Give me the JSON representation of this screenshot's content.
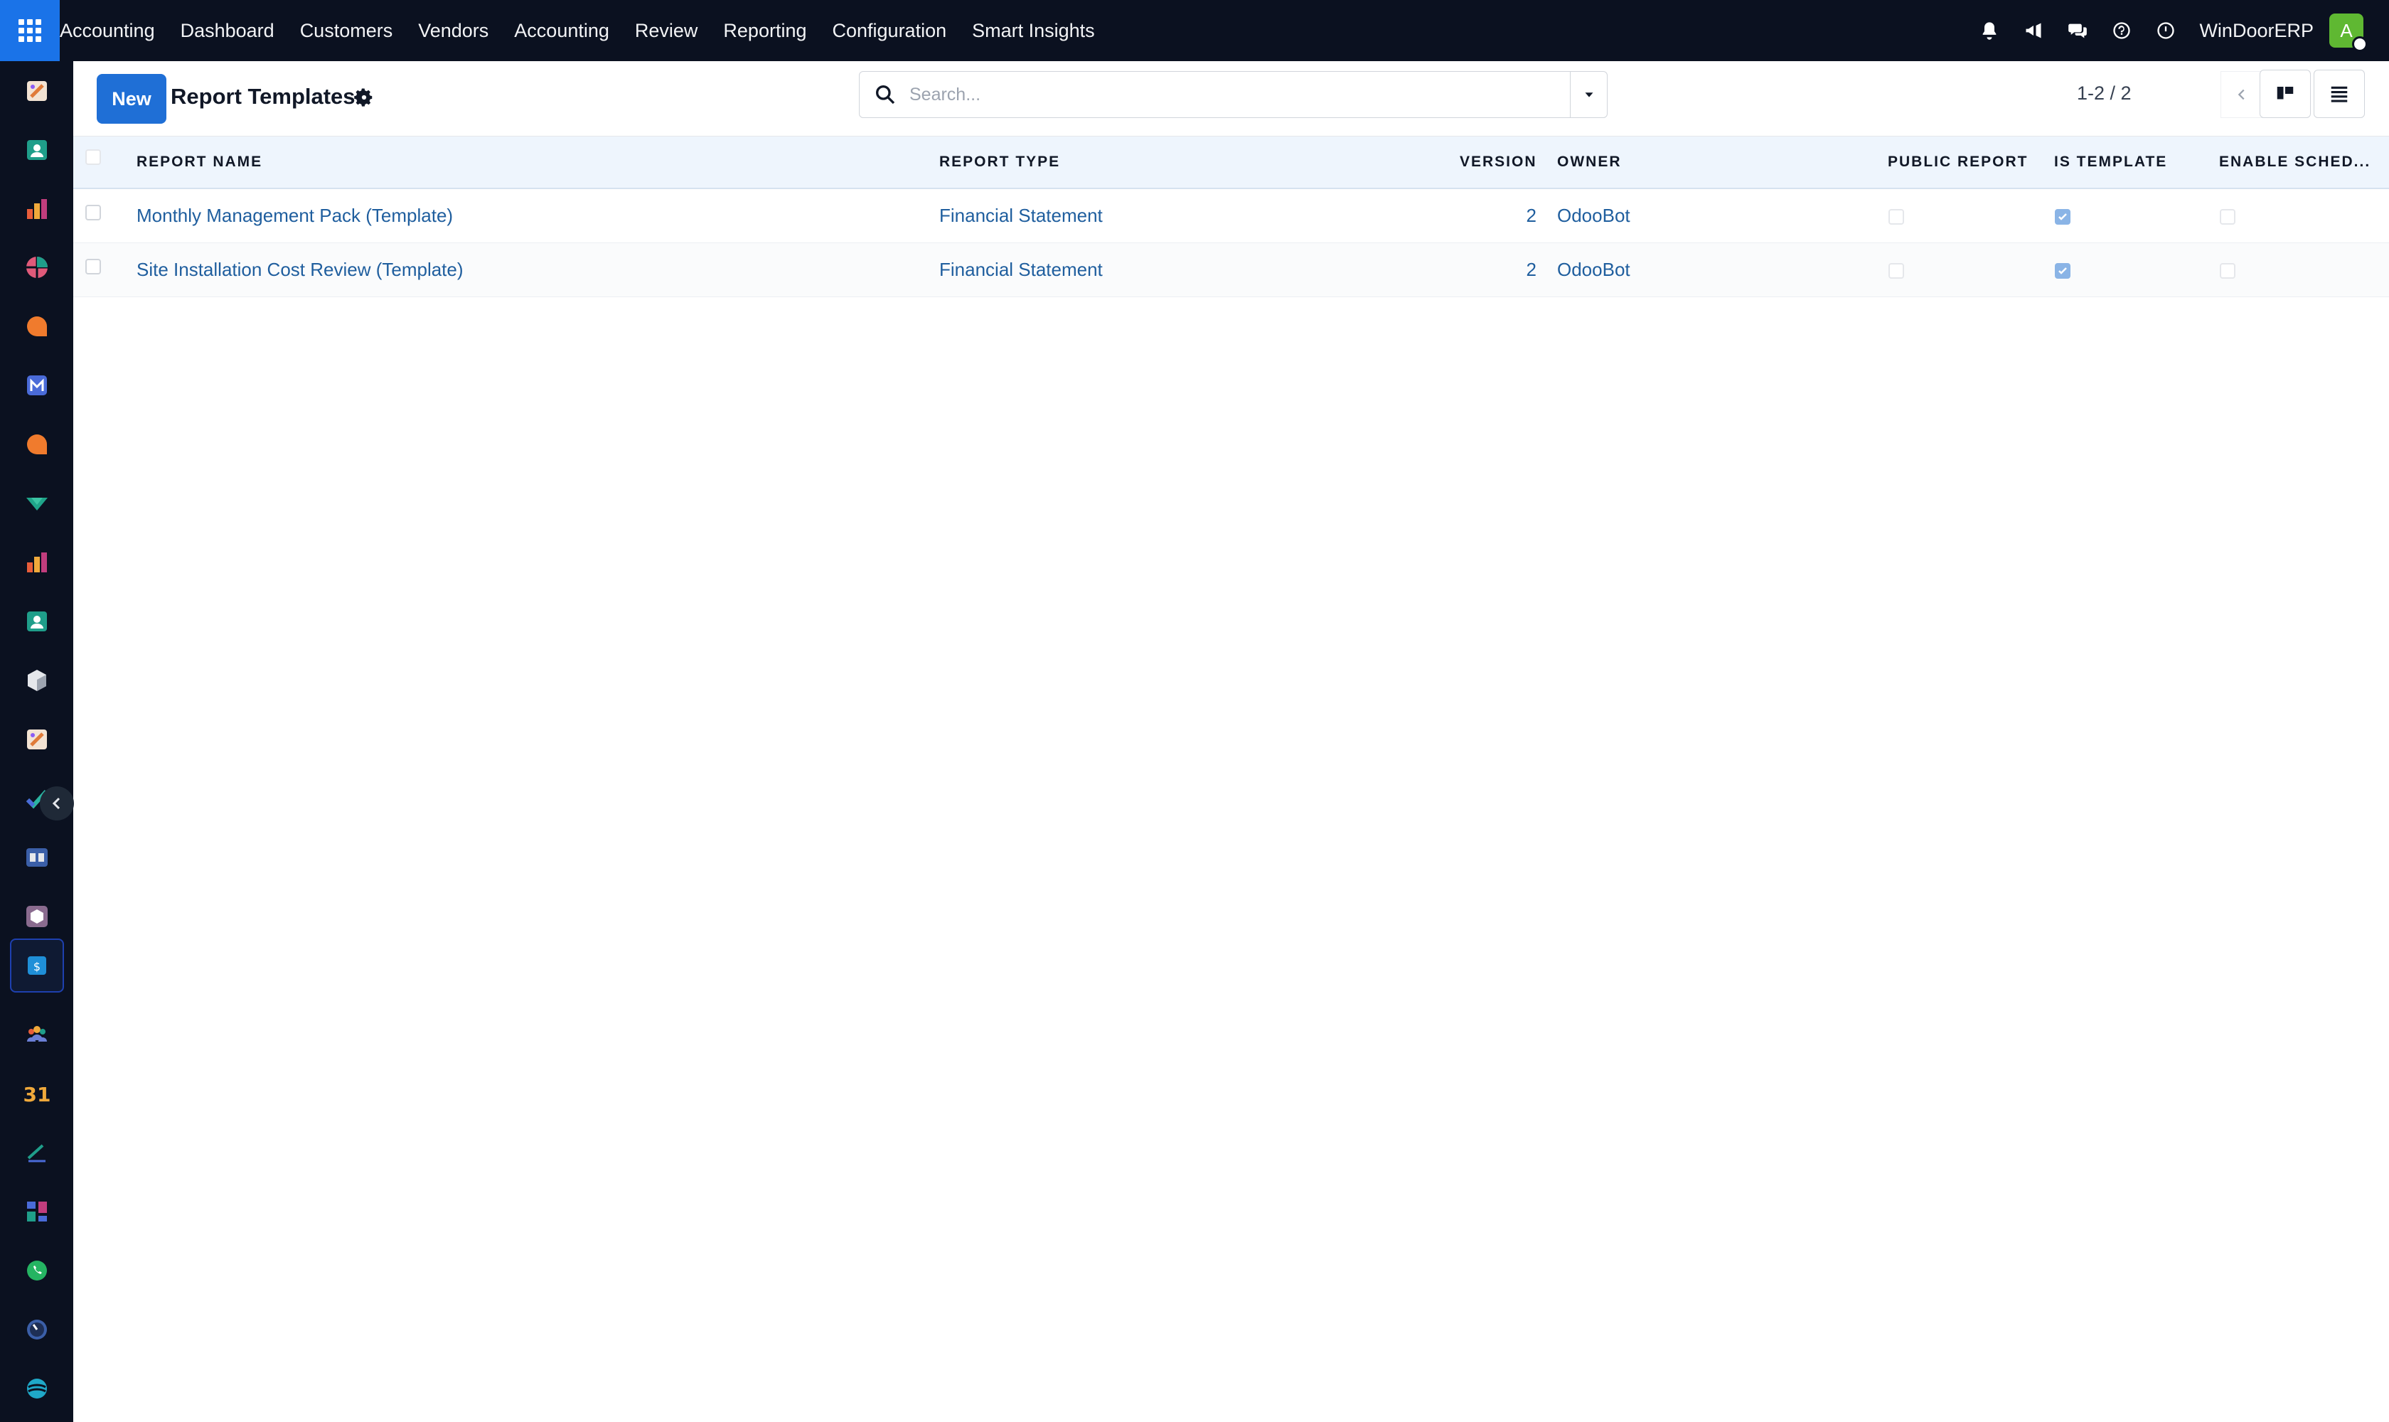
{
  "topbar": {
    "menu": [
      "Accounting",
      "Dashboard",
      "Customers",
      "Vendors",
      "Accounting",
      "Review",
      "Reporting",
      "Configuration",
      "Smart Insights"
    ],
    "company": "WinDoorERP",
    "avatar_letter": "A",
    "tray_icons": [
      "bell-icon",
      "megaphone-icon",
      "chat-icon",
      "help-icon",
      "clock-icon"
    ]
  },
  "sidebar": {
    "apps": [
      "accounting-app-icon",
      "contacts-app-icon",
      "reporting-app-icon",
      "dashboard-app-icon",
      "discuss-app-icon",
      "email-marketing-app-icon",
      "livechat-app-icon",
      "project-app-icon",
      "reports-app-icon",
      "employees-app-icon",
      "inventory-app-icon",
      "invoicing-app-icon",
      "todo-app-icon",
      "knowledge-app-icon",
      "website-app-icon",
      "accounting-reports-app-icon",
      "team-app-icon",
      "calendar-app-icon",
      "sign-app-icon",
      "dashboards-app-icon",
      "whatsapp-app-icon",
      "timer-app-icon",
      "odoo-app-icon"
    ],
    "calendar_label": "31"
  },
  "control": {
    "new_label": "New",
    "title": "Report Templates",
    "search_placeholder": "Search...",
    "pager": "1-2 / 2"
  },
  "table": {
    "headers": {
      "name": "REPORT NAME",
      "type": "REPORT TYPE",
      "version": "VERSION",
      "owner": "OWNER",
      "public": "PUBLIC REPORT",
      "template": "IS TEMPLATE",
      "schedule": "ENABLE SCHED..."
    },
    "rows": [
      {
        "name": "Monthly Management Pack (Template)",
        "type": "Financial Statement",
        "version": "2",
        "owner": "OdooBot",
        "public": false,
        "template": true,
        "schedule": false
      },
      {
        "name": "Site Installation Cost Review (Template)",
        "type": "Financial Statement",
        "version": "2",
        "owner": "OdooBot",
        "public": false,
        "template": true,
        "schedule": false
      }
    ]
  },
  "colors": {
    "topbar": "#0b1120",
    "primary": "#1f6fd6",
    "link": "#1f5e9e",
    "header_bg": "#eef5fd",
    "avatar": "#5fb832"
  }
}
